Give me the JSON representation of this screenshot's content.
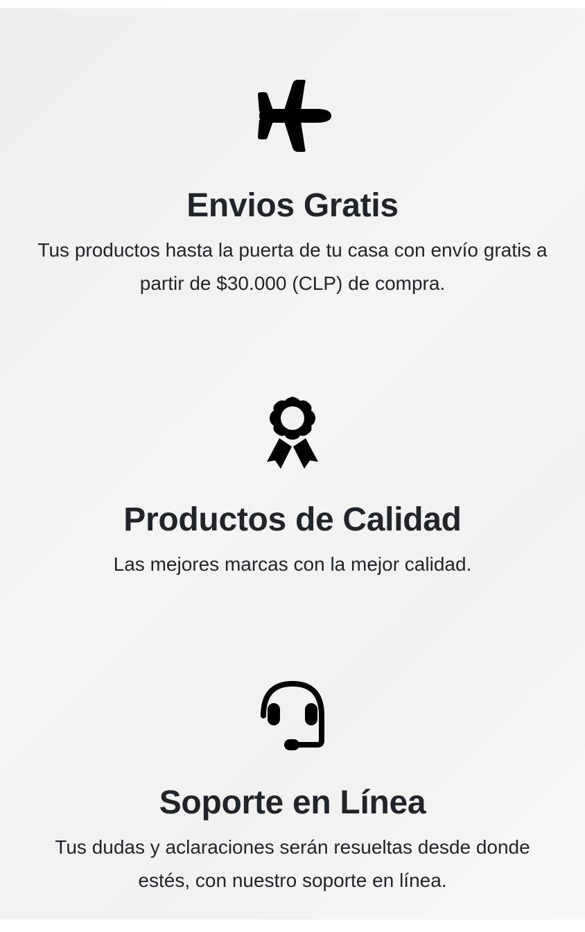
{
  "features": [
    {
      "icon": "airplane-icon",
      "title": "Envios Gratis",
      "description": "Tus productos hasta la puerta de tu casa con envío gratis a partir de $30.000 (CLP) de compra."
    },
    {
      "icon": "award-icon",
      "title": "Productos de Calidad",
      "description": "Las mejores marcas con la mejor calidad."
    },
    {
      "icon": "headset-icon",
      "title": "Soporte en Línea",
      "description": "Tus dudas y aclaraciones serán resueltas desde donde estés, con nuestro soporte en línea."
    }
  ],
  "colors": {
    "text": "#212529",
    "icon": "#000000",
    "panel_background": "#f2f2f2",
    "page_background": "#ffffff"
  }
}
